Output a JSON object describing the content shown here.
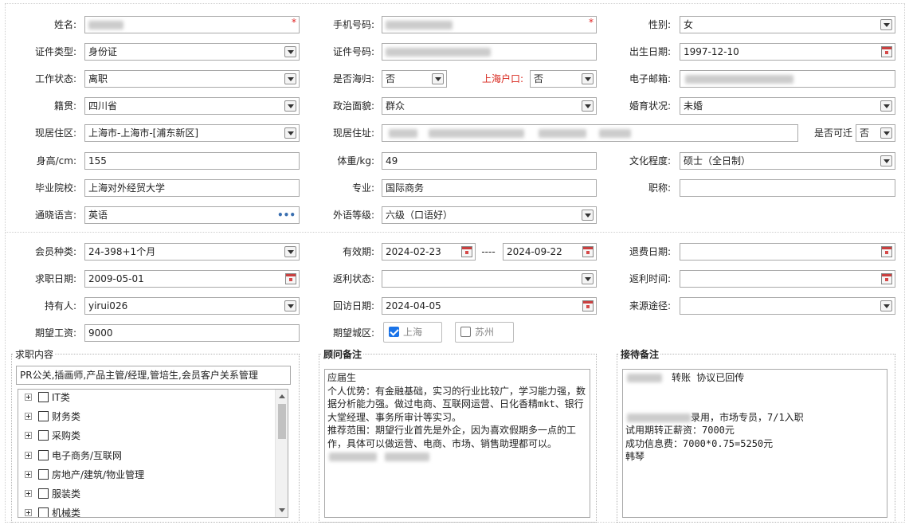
{
  "personal": {
    "name_label": "姓名:",
    "phone_label": "手机号码:",
    "gender_label": "性别:",
    "gender_value": "女",
    "idtype_label": "证件类型:",
    "idtype_value": "身份证",
    "idno_label": "证件号码:",
    "birth_label": "出生日期:",
    "birth_value": "1997-12-10",
    "workstatus_label": "工作状态:",
    "workstatus_value": "离职",
    "returnee_label": "是否海归:",
    "returnee_value": "否",
    "hukou_label": "上海户口:",
    "hukou_value": "否",
    "email_label": "电子邮箱:",
    "native_label": "籍贯:",
    "native_value": "四川省",
    "political_label": "政治面貌:",
    "political_value": "群众",
    "marital_label": "婚育状况:",
    "marital_value": "未婚",
    "residence_label": "现居住区:",
    "residence_value": "上海市-上海市-[浦东新区]",
    "address_label": "现居住址:",
    "relocate_label": "是否可迁",
    "relocate_value": "否",
    "height_label": "身高/cm:",
    "height_value": "155",
    "weight_label": "体重/kg:",
    "weight_value": "49",
    "education_label": "文化程度:",
    "education_value": "硕士（全日制）",
    "school_label": "毕业院校:",
    "school_value": "上海对外经贸大学",
    "major_label": "专业:",
    "major_value": "国际商务",
    "title_label": "职称:",
    "title_value": "",
    "language_label": "通晓语言:",
    "language_value": "英语",
    "language_more": "•••",
    "langlevel_label": "外语等级:",
    "langlevel_value": "六级（口语好）",
    "required_mark": "*"
  },
  "membership": {
    "type_label": "会员种类:",
    "type_value": "24-398+1个月",
    "valid_label": "有效期:",
    "valid_from": "2024-02-23",
    "valid_sep": "----",
    "valid_to": "2024-09-22",
    "refund_label": "退费日期:",
    "refund_value": "",
    "jobdate_label": "求职日期:",
    "jobdate_value": "2009-05-01",
    "rebate_label": "返利状态:",
    "rebate_value": "",
    "rebatetime_label": "返利时间:",
    "rebatetime_value": "",
    "holder_label": "持有人:",
    "holder_value": "yirui026",
    "revisit_label": "回访日期:",
    "revisit_value": "2024-04-05",
    "source_label": "来源途径:",
    "source_value": "",
    "salary_label": "期望工资:",
    "salary_value": "9000",
    "city_label": "期望城区:",
    "city_shanghai": "上海",
    "city_suzhou": "苏州",
    "city_shanghai_checked": true,
    "city_suzhou_checked": false
  },
  "job_content": {
    "legend": "求职内容",
    "summary": "PR公关,插画师,产品主管/经理,管培生,会员客户关系管理",
    "tree": [
      {
        "label": "IT类"
      },
      {
        "label": "财务类"
      },
      {
        "label": "采购类"
      },
      {
        "label": "电子商务/互联网"
      },
      {
        "label": "房地产/建筑/物业管理"
      },
      {
        "label": "服装类"
      },
      {
        "label": "机械类"
      }
    ]
  },
  "advisor_notes": {
    "legend": "顾问备注",
    "lines": [
      "应届生",
      "个人优势：有金融基础，实习的行业比较广，学习能力强，数据分析能力强。做过电商、互联网运营、日化香精mkt、银行大堂经理、事务所审计等实习。",
      "推荐范围：期望行业首先是外企，因为喜欢假期多一点的工作，具体可以做运营、电商、市场、销售助理都可以。"
    ]
  },
  "reception_notes": {
    "legend": "接待备注",
    "line1": "转账 协议已回传",
    "line2": "录用，市场专员，7/1入职",
    "line3": "试用期转正薪资：7000元",
    "line4": "成功信息费：7000*0.75=5250元",
    "line5": "韩琴"
  },
  "colors": {
    "accent_red": "#d8261c",
    "checkbox_blue": "#1a73e8",
    "border": "#a9a9a9"
  }
}
